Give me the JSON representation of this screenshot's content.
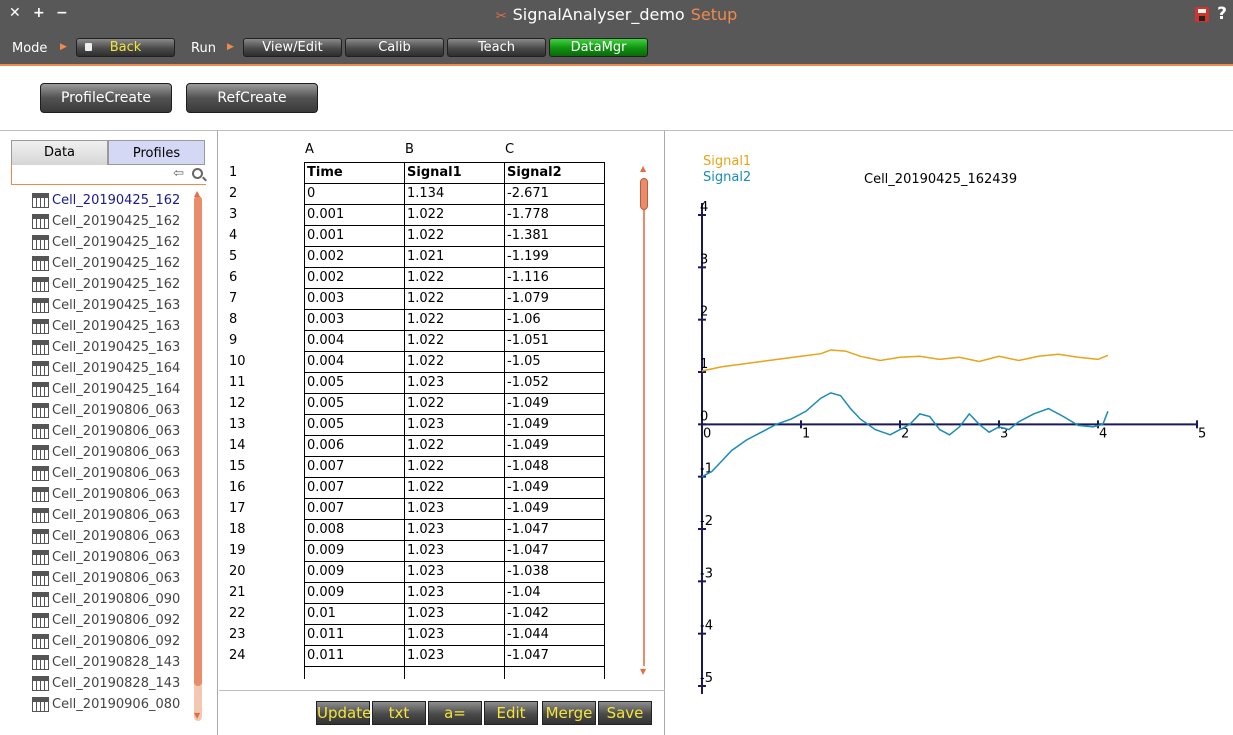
{
  "window": {
    "title": "SignalAnalyser_demo",
    "mode_name": "Setup",
    "close_glyph": "✕",
    "maximize_glyph": "+",
    "minimize_glyph": "−",
    "help_glyph": "?"
  },
  "modebar": {
    "mode_label": "Mode",
    "run_label": "Run",
    "buttons": {
      "back": "Back",
      "view_edit": "View/Edit",
      "calib": "Calib",
      "teach": "Teach",
      "datamgr": "DataMgr"
    },
    "active": "DataMgr"
  },
  "actions": {
    "profile_create": "ProfileCreate",
    "ref_create": "RefCreate"
  },
  "left": {
    "tabs": {
      "data": "Data",
      "profiles": "Profiles"
    },
    "search_value": "",
    "files": [
      "Cell_20190425_162",
      "Cell_20190425_162",
      "Cell_20190425_162",
      "Cell_20190425_162",
      "Cell_20190425_162",
      "Cell_20190425_163",
      "Cell_20190425_163",
      "Cell_20190425_163",
      "Cell_20190425_164",
      "Cell_20190425_164",
      "Cell_20190806_063",
      "Cell_20190806_063",
      "Cell_20190806_063",
      "Cell_20190806_063",
      "Cell_20190806_063",
      "Cell_20190806_063",
      "Cell_20190806_063",
      "Cell_20190806_063",
      "Cell_20190806_063",
      "Cell_20190806_090",
      "Cell_20190806_092",
      "Cell_20190806_092",
      "Cell_20190828_143",
      "Cell_20190828_143",
      "Cell_20190906_080"
    ]
  },
  "grid": {
    "column_letters": [
      "A",
      "B",
      "C"
    ],
    "row_numbers": [
      "1",
      "2",
      "3",
      "4",
      "5",
      "6",
      "7",
      "8",
      "9",
      "10",
      "11",
      "12",
      "13",
      "14",
      "15",
      "16",
      "17",
      "18",
      "19",
      "20",
      "21",
      "22",
      "23",
      "24"
    ],
    "header": [
      "Time",
      "Signal1",
      "Signal2"
    ],
    "rows": [
      [
        "0",
        "1.134",
        "-2.671"
      ],
      [
        "0.001",
        "1.022",
        "-1.778"
      ],
      [
        "0.001",
        "1.022",
        "-1.381"
      ],
      [
        "0.002",
        "1.021",
        "-1.199"
      ],
      [
        "0.002",
        "1.022",
        "-1.116"
      ],
      [
        "0.003",
        "1.022",
        "-1.079"
      ],
      [
        "0.003",
        "1.022",
        "-1.06"
      ],
      [
        "0.004",
        "1.022",
        "-1.051"
      ],
      [
        "0.004",
        "1.022",
        "-1.05"
      ],
      [
        "0.005",
        "1.023",
        "-1.052"
      ],
      [
        "0.005",
        "1.022",
        "-1.049"
      ],
      [
        "0.005",
        "1.023",
        "-1.049"
      ],
      [
        "0.006",
        "1.022",
        "-1.049"
      ],
      [
        "0.007",
        "1.022",
        "-1.048"
      ],
      [
        "0.007",
        "1.022",
        "-1.049"
      ],
      [
        "0.007",
        "1.023",
        "-1.049"
      ],
      [
        "0.008",
        "1.023",
        "-1.047"
      ],
      [
        "0.009",
        "1.023",
        "-1.047"
      ],
      [
        "0.009",
        "1.023",
        "-1.038"
      ],
      [
        "0.009",
        "1.023",
        "-1.04"
      ],
      [
        "0.01",
        "1.023",
        "-1.042"
      ],
      [
        "0.011",
        "1.023",
        "-1.044"
      ],
      [
        "0.011",
        "1.023",
        "-1.047"
      ]
    ],
    "buttons": [
      "Update",
      "txt",
      "a=",
      "Edit",
      "Merge",
      "Save"
    ]
  },
  "colors": {
    "accent": "#f08a4b",
    "active_green": "#109010",
    "signal1": "#e8a318",
    "signal2": "#1a8ab8",
    "axis": "#1a1a5a"
  },
  "chart_data": {
    "type": "line",
    "title": "Cell_20190425_162439",
    "xlabel": "",
    "ylabel": "",
    "xlim": [
      0,
      5
    ],
    "ylim": [
      -5,
      4
    ],
    "xticks": [
      "0",
      "1",
      "2",
      "3",
      "4",
      "5"
    ],
    "yticks": [
      "4",
      "3",
      "2",
      "1",
      "0",
      "-1",
      "-2",
      "-3",
      "-4",
      "-5"
    ],
    "legend_position": "top-left",
    "series": [
      {
        "name": "Signal1",
        "x": [
          0,
          0.2,
          0.4,
          0.6,
          0.8,
          1.0,
          1.2,
          1.3,
          1.45,
          1.6,
          1.8,
          2.0,
          2.2,
          2.4,
          2.6,
          2.8,
          3.0,
          3.2,
          3.4,
          3.6,
          3.8,
          4.0,
          4.1
        ],
        "y": [
          1.02,
          1.1,
          1.15,
          1.2,
          1.25,
          1.3,
          1.35,
          1.42,
          1.4,
          1.3,
          1.22,
          1.28,
          1.3,
          1.24,
          1.28,
          1.2,
          1.3,
          1.22,
          1.3,
          1.34,
          1.28,
          1.24,
          1.32
        ]
      },
      {
        "name": "Signal2",
        "x": [
          0,
          0.1,
          0.2,
          0.3,
          0.45,
          0.6,
          0.75,
          0.9,
          1.05,
          1.2,
          1.3,
          1.4,
          1.5,
          1.6,
          1.75,
          1.9,
          2.0,
          2.1,
          2.2,
          2.3,
          2.4,
          2.5,
          2.6,
          2.7,
          2.8,
          2.9,
          3.0,
          3.1,
          3.2,
          3.35,
          3.5,
          3.65,
          3.8,
          3.95,
          4.05,
          4.1
        ],
        "y": [
          -1.0,
          -0.9,
          -0.7,
          -0.5,
          -0.3,
          -0.15,
          0.0,
          0.1,
          0.25,
          0.5,
          0.6,
          0.55,
          0.3,
          0.1,
          -0.1,
          -0.2,
          -0.1,
          0.0,
          0.2,
          0.15,
          -0.1,
          -0.2,
          -0.05,
          0.2,
          0.0,
          -0.15,
          -0.05,
          -0.1,
          0.05,
          0.2,
          0.3,
          0.15,
          -0.02,
          -0.05,
          0.0,
          0.25
        ]
      }
    ]
  }
}
